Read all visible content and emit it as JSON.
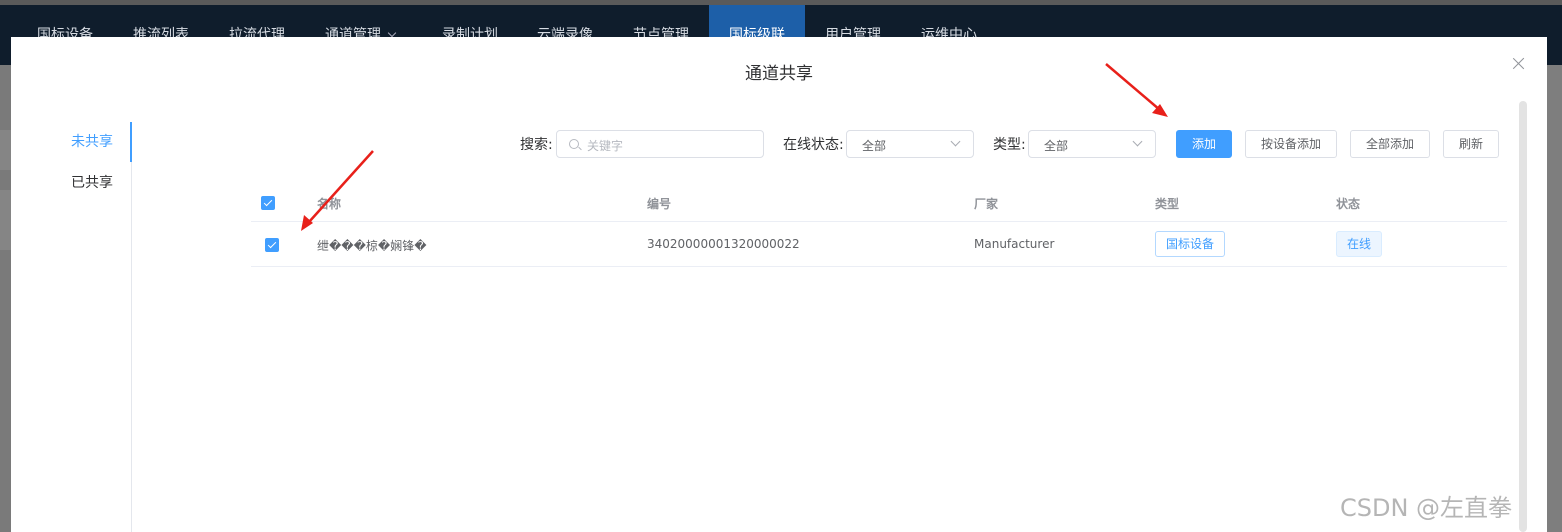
{
  "nav": {
    "items": [
      "国标设备",
      "推流列表",
      "拉流代理",
      "通道管理",
      "录制计划",
      "云端录像",
      "节点管理",
      "国标级联",
      "用户管理",
      "运维中心"
    ],
    "active": "国标级联"
  },
  "dialog": {
    "title": "通道共享",
    "tabs": {
      "unshared": "未共享",
      "shared": "已共享",
      "active": "未共享"
    },
    "toolbar": {
      "search_label": "搜索:",
      "search_placeholder": "关键字",
      "online_label": "在线状态:",
      "online_value": "全部",
      "type_label": "类型:",
      "type_value": "全部",
      "add": "添加",
      "add_by_device": "按设备添加",
      "add_all": "全部添加",
      "refresh": "刷新"
    },
    "table": {
      "columns": [
        "名称",
        "编号",
        "厂家",
        "类型",
        "状态"
      ],
      "rows": [
        {
          "name": "绁���椋�娴锋�",
          "code": "34020000001320000022",
          "manufacturer": "Manufacturer",
          "type": "国标设备",
          "status": "在线",
          "checked": true
        }
      ]
    }
  },
  "colors": {
    "primary": "#409eff",
    "navbar": "#0f1d2c",
    "nav_active": "#1d5fa8",
    "annotation": "#e8201a"
  },
  "watermark": "CSDN @左直拳"
}
